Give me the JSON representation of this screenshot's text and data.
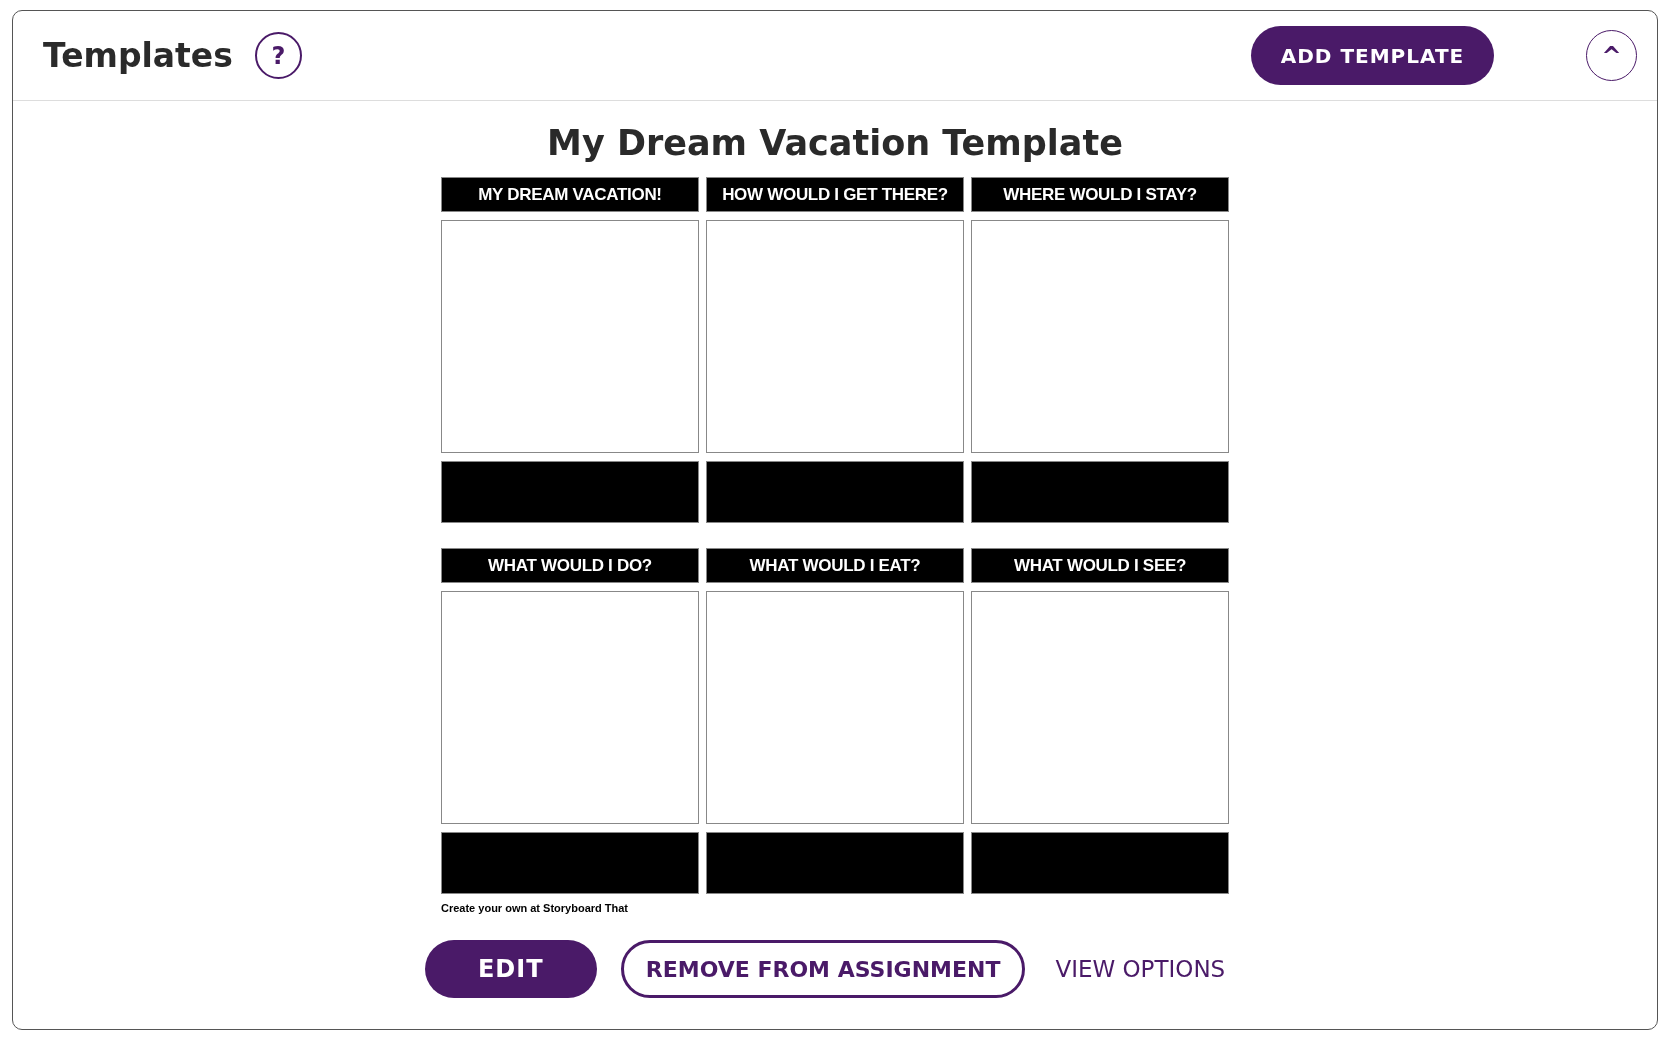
{
  "header": {
    "title": "Templates",
    "help_icon": "?",
    "add_button": "ADD TEMPLATE",
    "collapse_icon": "^"
  },
  "template": {
    "title": "My Dream Vacation Template",
    "cells": [
      {
        "heading": "MY DREAM VACATION!"
      },
      {
        "heading": "HOW WOULD I GET THERE?"
      },
      {
        "heading": "WHERE WOULD I STAY?"
      },
      {
        "heading": "WHAT WOULD I DO?"
      },
      {
        "heading": "WHAT WOULD I EAT?"
      },
      {
        "heading": "WHAT WOULD I SEE?"
      }
    ],
    "credit": "Create your own at Storyboard That"
  },
  "actions": {
    "edit": "EDIT",
    "remove": "REMOVE FROM ASSIGNMENT",
    "view_options": "VIEW OPTIONS"
  }
}
